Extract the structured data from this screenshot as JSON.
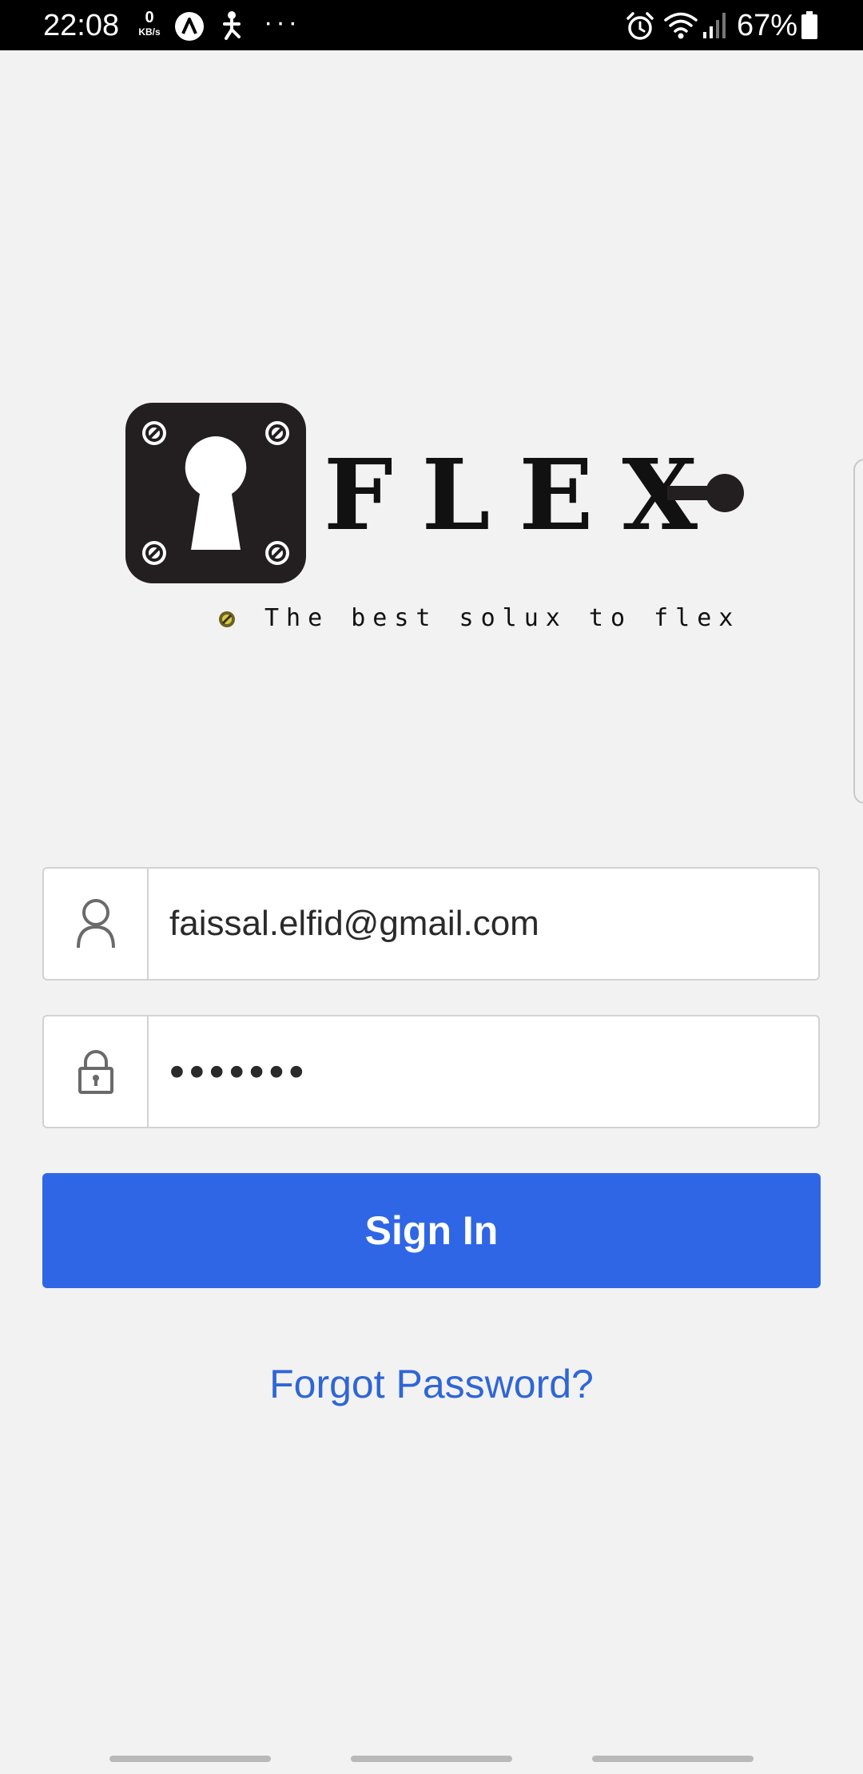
{
  "status_bar": {
    "time": "22:08",
    "net_speed_value": "0",
    "net_speed_unit": "KB/s",
    "overflow": "···",
    "battery_percent": "67%",
    "icons": [
      "a-icon",
      "accessibility-icon",
      "alarm-icon",
      "wifi-icon",
      "signal-icon",
      "battery-icon"
    ]
  },
  "logo": {
    "wordmark": "FLEX",
    "tagline": "The best solux to flex",
    "icons": [
      "keyhole-plate-icon",
      "key-icon",
      "screw-icon"
    ]
  },
  "form": {
    "email": {
      "value": "faissal.elfid@gmail.com",
      "icon": "user-icon"
    },
    "password": {
      "value": "•••••••",
      "icon": "lock-icon"
    },
    "sign_in_label": "Sign In",
    "forgot_password_label": "Forgot Password?"
  },
  "colors": {
    "primary": "#2f66e6",
    "link": "#2f66d6",
    "background": "#f2f2f2",
    "status_bar": "#000000",
    "logo_dark": "#231f20"
  }
}
